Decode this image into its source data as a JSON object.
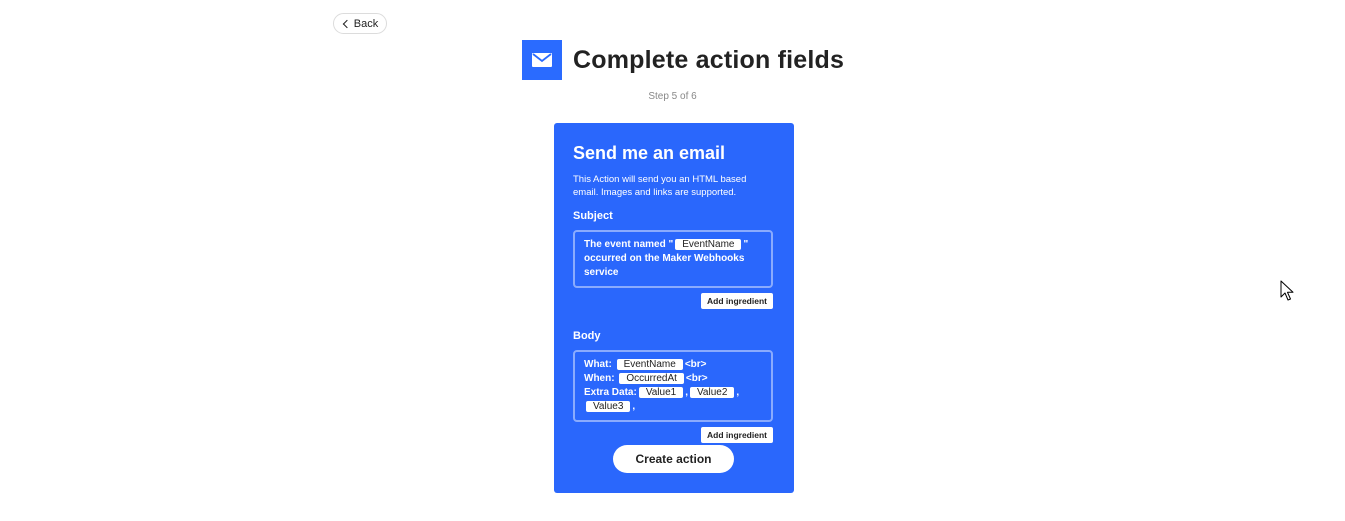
{
  "back_label": "Back",
  "header": {
    "title": "Complete action fields",
    "step": "Step 5 of 6",
    "icon": "email-icon",
    "accent_color": "#2a6bff"
  },
  "card": {
    "title": "Send me an email",
    "description": "This Action will send you an HTML based email. Images and links are supported.",
    "background_color": "#2a67fc",
    "subject": {
      "label": "Subject",
      "text_1": "The event named \"",
      "chip_1": "EventName",
      "text_2": "\" occurred on the Maker Webhooks service",
      "ingredient_label": "Add ingredient"
    },
    "body": {
      "label": "Body",
      "what_label": "What:",
      "what_chip": "EventName",
      "br_1": "<br>",
      "when_label": "When:",
      "when_chip": "OccurredAt",
      "br_2": "<br>",
      "extra_label": "Extra Data:",
      "value1_chip": "Value1",
      "comma_1": ",",
      "value2_chip": "Value2",
      "comma_2": ",",
      "value3_chip": "Value3",
      "comma_3": ",",
      "ingredient_label": "Add ingredient"
    },
    "create_label": "Create action"
  }
}
